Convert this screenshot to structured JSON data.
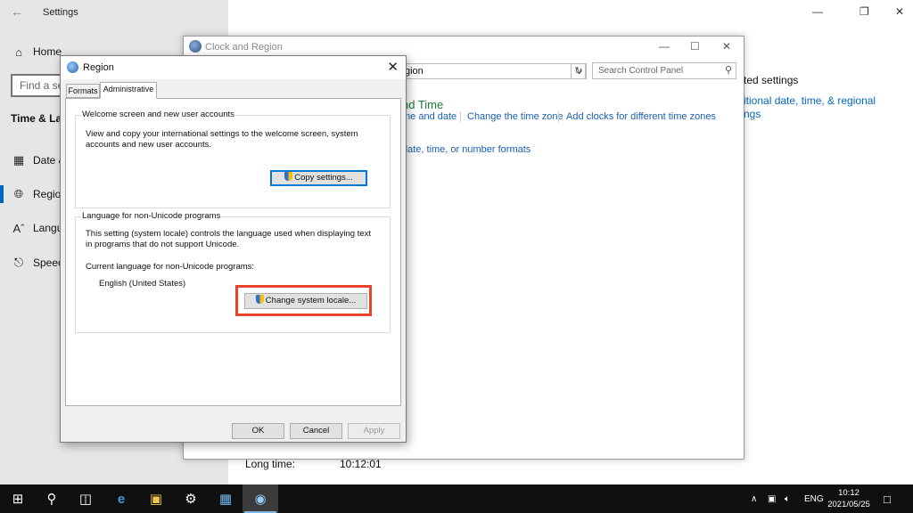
{
  "settings": {
    "title": "Settings",
    "find_placeholder": "Find a set",
    "nav_home": "Home",
    "section_heading": "Time & Lan",
    "nav": [
      {
        "label": "Date &",
        "icon": "calendar-icon"
      },
      {
        "label": "Region",
        "icon": "globe-icon"
      },
      {
        "label": "Langu",
        "icon": "language-icon"
      },
      {
        "label": "Speec",
        "icon": "microphone-icon"
      }
    ],
    "related_heading": "ted settings",
    "related_link_line1": "itional date, time, & regional",
    "related_link_line2": "ngs",
    "long_time_label": "Long time:",
    "long_time_value": "10:12:01"
  },
  "clock_region": {
    "title": "Clock and Region",
    "address": "gion",
    "search_placeholder": "Search Control Panel",
    "category_title": "nd Time",
    "links": [
      "me and date",
      "Change the time zone",
      "Add clocks for different time zones"
    ],
    "region_link": "date, time, or number formats"
  },
  "region_dialog": {
    "title": "Region",
    "tabs": [
      "Formats",
      "Administrative"
    ],
    "welcome_group": {
      "label": "Welcome screen and new user accounts",
      "text": "View and copy your international settings to the welcome screen, system accounts and new user accounts.",
      "button": "Copy settings..."
    },
    "unicode_group": {
      "label": "Language for non-Unicode programs",
      "text": "This setting (system locale) controls the language used when displaying text in programs that do not support Unicode.",
      "current_label": "Current language for non-Unicode programs:",
      "current_value": "English (United States)",
      "button": "Change system locale..."
    },
    "ok": "OK",
    "cancel": "Cancel",
    "apply": "Apply"
  },
  "taskbar": {
    "language": "ENG",
    "time": "10:12",
    "date": "2021/05/25"
  }
}
